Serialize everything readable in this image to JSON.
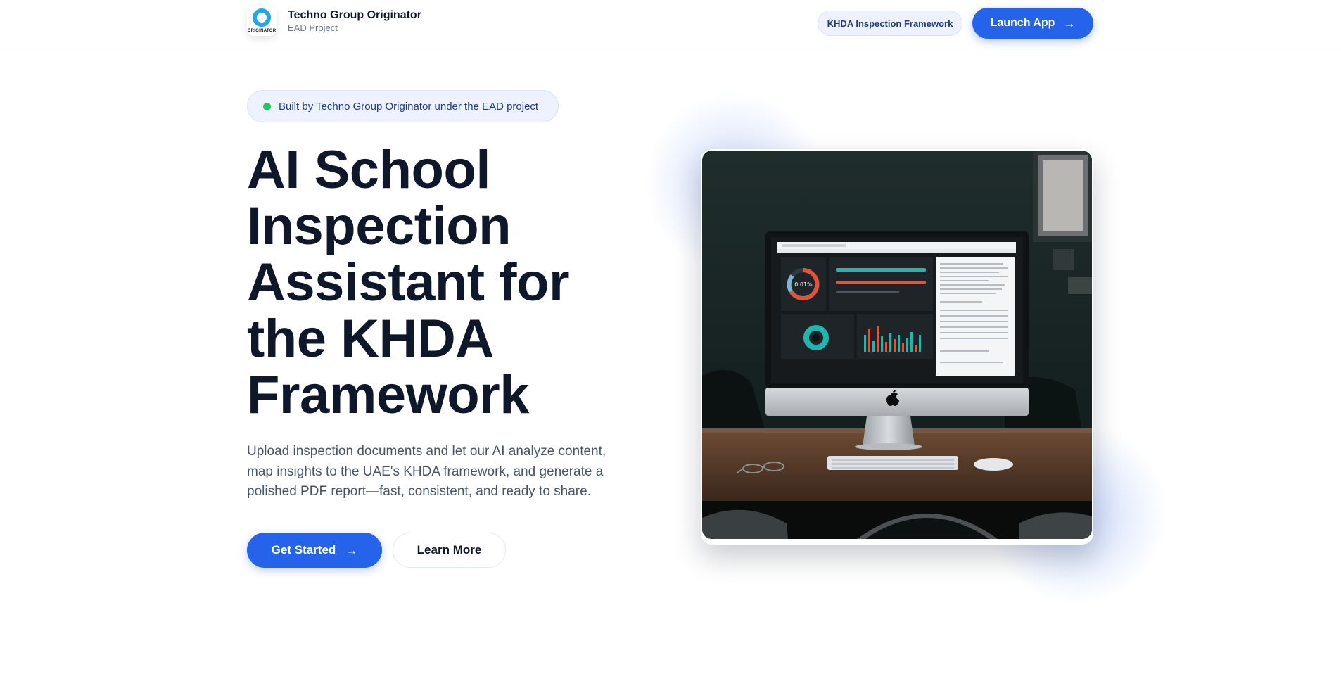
{
  "header": {
    "brand_name": "Techno Group Originator",
    "brand_sub": "EAD Project",
    "logo_text": "ORIGINATOR",
    "nav_pill": "KHDA Inspection Framework",
    "launch_label": "Launch App"
  },
  "hero": {
    "badge": "Built by Techno Group Originator under the EAD project",
    "headline": "AI School Inspection Assistant for the KHDA Framework",
    "subtext": "Upload inspection documents and let our AI analyze content, map insights to the UAE's KHDA framework, and generate a polished PDF report—fast, consistent, and ready to share.",
    "primary_label": "Get Started",
    "secondary_label": "Learn More",
    "screen_gauge_value": "0.01%"
  },
  "colors": {
    "accent": "#2563eb",
    "status_dot": "#22c55e",
    "heading": "#0f172a",
    "body": "#475569"
  },
  "icons": {
    "arrow": "arrow-right-icon",
    "logo": "originator-logo-icon"
  }
}
